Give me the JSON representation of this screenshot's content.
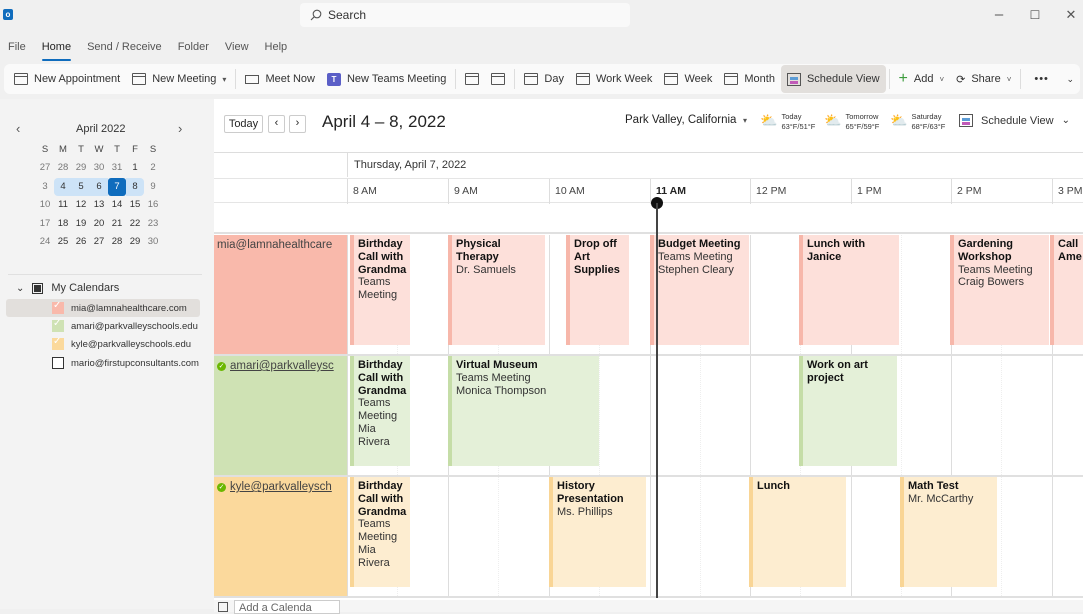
{
  "titlebar": {
    "search_placeholder": "Search",
    "app_icon": "outlook-icon",
    "window_controls": {
      "minimize": "–",
      "maximize": "☐",
      "close": "✕"
    }
  },
  "menu": [
    {
      "label": "File"
    },
    {
      "label": "Home",
      "active": true
    },
    {
      "label": "Send / Receive"
    },
    {
      "label": "Folder"
    },
    {
      "label": "View"
    },
    {
      "label": "Help"
    }
  ],
  "ribbon": {
    "new_appointment": "New Appointment",
    "new_meeting": "New Meeting",
    "meet_now": "Meet Now",
    "new_teams_meeting": "New Teams Meeting",
    "day": "Day",
    "work_week": "Work Week",
    "week": "Week",
    "month": "Month",
    "schedule_view": "Schedule View",
    "add": "Add",
    "share": "Share",
    "more": "•••"
  },
  "mini_calendar": {
    "title": "April 2022",
    "weekdays": [
      "S",
      "M",
      "T",
      "W",
      "T",
      "F",
      "S"
    ],
    "weeks": [
      [
        "27",
        "28",
        "29",
        "30",
        "31",
        "1",
        "2"
      ],
      [
        "3",
        "4",
        "5",
        "6",
        "7",
        "8",
        "9"
      ],
      [
        "10",
        "11",
        "12",
        "13",
        "14",
        "15",
        "16"
      ],
      [
        "17",
        "18",
        "19",
        "20",
        "21",
        "22",
        "23"
      ],
      [
        "24",
        "25",
        "26",
        "27",
        "28",
        "29",
        "30"
      ]
    ],
    "selected_day": "7"
  },
  "calendars": {
    "group_label": "My Calendars",
    "items": [
      {
        "label": "mia@lamnahealthcare.com",
        "color": "#f9b9ab",
        "checked": true
      },
      {
        "label": "amari@parkvalleyschools.edu",
        "color": "#cfe2b4",
        "checked": true
      },
      {
        "label": "kyle@parkvalleyschools.edu",
        "color": "#fbd99c",
        "checked": true
      },
      {
        "label": "mario@firstupconsultants.com",
        "color": "#ffffff",
        "checked": false
      }
    ]
  },
  "header": {
    "today_label": "Today",
    "prev": "‹",
    "next": "›",
    "range_title": "April 4 – 8, 2022",
    "location": "Park Valley, California",
    "weather": [
      {
        "day": "Today",
        "temps": "63°F/51°F"
      },
      {
        "day": "Tomorrow",
        "temps": "65°F/59°F"
      },
      {
        "day": "Saturday",
        "temps": "68°F/63°F"
      }
    ],
    "view_label": "Schedule View"
  },
  "schedule": {
    "day_label": "Thursday, April 7, 2022",
    "hours": [
      "8 AM",
      "9 AM",
      "10 AM",
      "11 AM",
      "12 PM",
      "1 PM",
      "2 PM",
      "3 PM"
    ],
    "current_hour": "11 AM",
    "rows": [
      {
        "label": "mia@lamnahealthcare",
        "events": [
          {
            "title": "Birthday Call with Grandma",
            "lines": [
              "Teams Meeting"
            ]
          },
          {
            "title": "Physical Therapy",
            "lines": [
              "Dr. Samuels"
            ]
          },
          {
            "title": "Drop off Art Supplies",
            "lines": []
          },
          {
            "title": "Budget Meeting",
            "lines": [
              "Teams Meeting",
              "Stephen Cleary"
            ]
          },
          {
            "title": "Lunch with Janice",
            "lines": []
          },
          {
            "title": "Gardening Workshop",
            "lines": [
              "Teams Meeting",
              "Craig Bowers"
            ]
          },
          {
            "title": "Call Ame",
            "lines": []
          }
        ]
      },
      {
        "label": "amari@parkvalleysc",
        "events": [
          {
            "title": "Birthday Call with Grandma",
            "lines": [
              "Teams Meeting",
              "Mia Rivera"
            ]
          },
          {
            "title": "Virtual Museum",
            "lines": [
              "Teams Meeting",
              "Monica Thompson"
            ]
          },
          {
            "title": "Work on art project",
            "lines": []
          }
        ]
      },
      {
        "label": "kyle@parkvalleysch",
        "events": [
          {
            "title": "Birthday Call with Grandma",
            "lines": [
              "Teams Meeting",
              "Mia Rivera"
            ]
          },
          {
            "title": "History Presentation",
            "lines": [
              "Ms. Phillips"
            ]
          },
          {
            "title": "Lunch",
            "lines": []
          },
          {
            "title": "Math Test",
            "lines": [
              "Mr. McCarthy"
            ]
          }
        ]
      }
    ],
    "add_calendar_placeholder": "Add a Calenda"
  }
}
